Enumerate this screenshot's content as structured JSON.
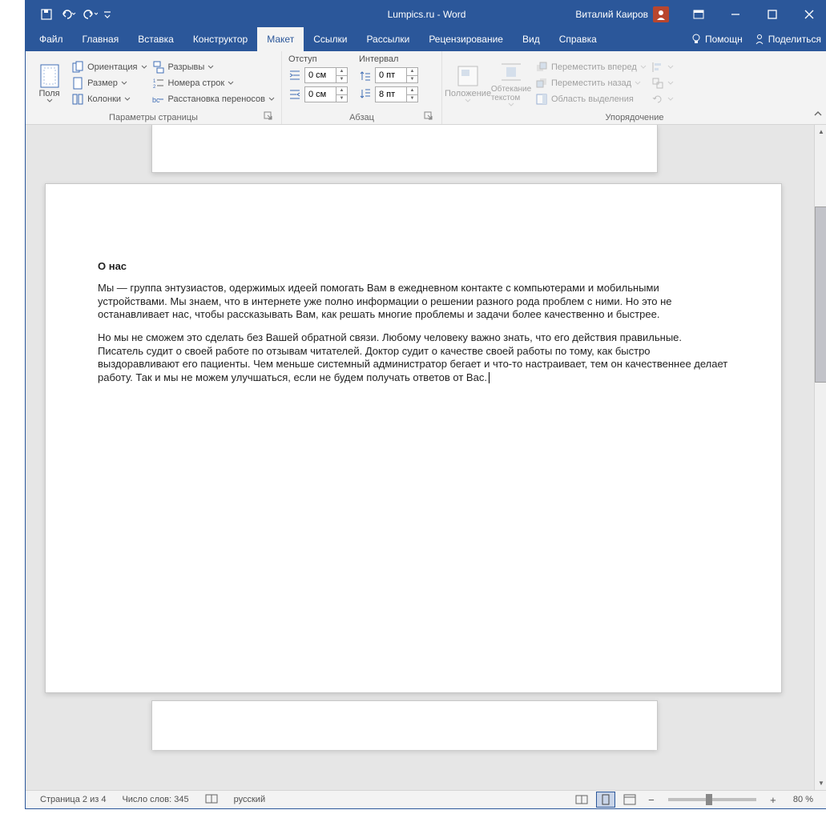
{
  "titlebar": {
    "title": "Lumpics.ru  -  Word",
    "user": "Виталий Каиров"
  },
  "tabs": {
    "file": "Файл",
    "home": "Главная",
    "insert": "Вставка",
    "design": "Конструктор",
    "layout": "Макет",
    "references": "Ссылки",
    "mailings": "Рассылки",
    "review": "Рецензирование",
    "view": "Вид",
    "help": "Справка",
    "tellme": "Помощн",
    "share": "Поделиться"
  },
  "ribbon": {
    "page_setup": {
      "label": "Параметры страницы",
      "margins": "Поля",
      "orientation": "Ориентация",
      "size": "Размер",
      "columns": "Колонки",
      "breaks": "Разрывы",
      "line_numbers": "Номера строк",
      "hyphenation": "Расстановка переносов"
    },
    "paragraph": {
      "label": "Абзац",
      "indent_label": "Отступ",
      "spacing_label": "Интервал",
      "indent_left": "0 см",
      "indent_right": "0 см",
      "space_before": "0 пт",
      "space_after": "8 пт"
    },
    "arrange": {
      "label": "Упорядочение",
      "position": "Положение",
      "wrap": "Обтекание текстом",
      "bring_forward": "Переместить вперед",
      "send_backward": "Переместить назад",
      "selection_pane": "Область выделения"
    }
  },
  "document": {
    "heading": "О нас",
    "para1": "Мы — группа энтузиастов, одержимых идеей помогать Вам в ежедневном контакте с компьютерами и мобильными устройствами. Мы знаем, что в интернете уже полно информации о решении разного рода проблем с ними. Но это не останавливает нас, чтобы рассказывать Вам, как решать многие проблемы и задачи более качественно и быстрее.",
    "para2": "Но мы не сможем это сделать без Вашей обратной связи. Любому человеку важно знать, что его действия правильные. Писатель судит о своей работе по отзывам читателей. Доктор судит о качестве своей работы по тому, как быстро выздоравливают его пациенты. Чем меньше системный администратор бегает и что-то настраивает, тем он качественнее делает работу. Так и мы не можем улучшаться, если не будем получать ответов от Вас."
  },
  "statusbar": {
    "page": "Страница 2 из 4",
    "words": "Число слов: 345",
    "language": "русский",
    "zoom": "80 %"
  }
}
